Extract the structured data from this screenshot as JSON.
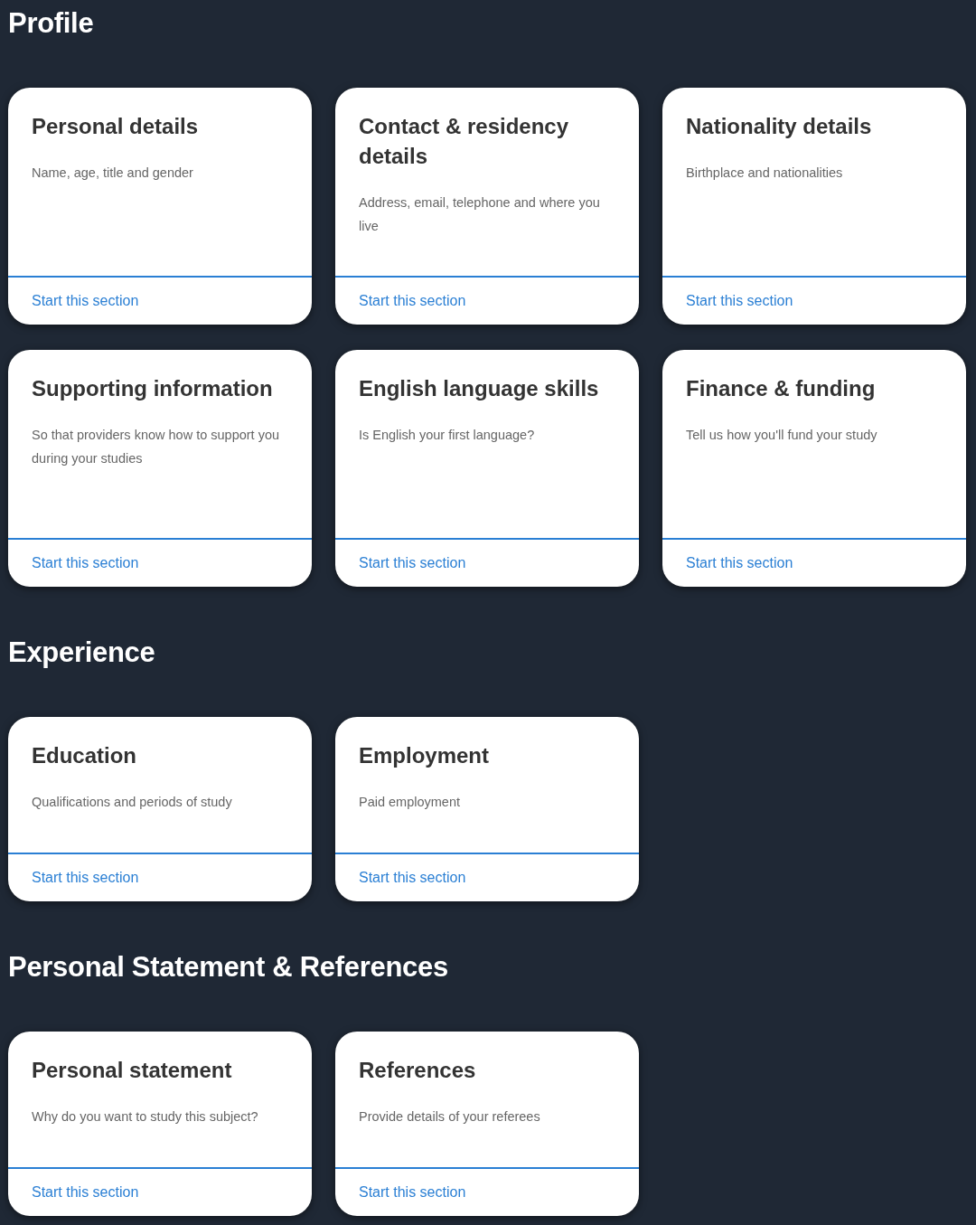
{
  "sections": [
    {
      "title": "Profile",
      "cards": [
        {
          "title": "Personal details",
          "description": "Name, age, title and gender",
          "link": "Start this section"
        },
        {
          "title": "Contact & residency details",
          "description": "Address, email, telephone and where you live",
          "link": "Start this section"
        },
        {
          "title": "Nationality details",
          "description": "Birthplace and nationalities",
          "link": "Start this section"
        },
        {
          "title": "Supporting information",
          "description": "So that providers know how to support you during your studies",
          "link": "Start this section"
        },
        {
          "title": "English language skills",
          "description": "Is English your first language?",
          "link": "Start this section"
        },
        {
          "title": "Finance & funding",
          "description": "Tell us how you'll fund your study",
          "link": "Start this section"
        }
      ]
    },
    {
      "title": "Experience",
      "cards": [
        {
          "title": "Education",
          "description": "Qualifications and periods of study",
          "link": "Start this section"
        },
        {
          "title": "Employment",
          "description": "Paid employment",
          "link": "Start this section"
        }
      ]
    },
    {
      "title": "Personal Statement & References",
      "cards": [
        {
          "title": "Personal statement",
          "description": "Why do you want to study this subject?",
          "link": "Start this section"
        },
        {
          "title": "References",
          "description": "Provide details of your referees",
          "link": "Start this section"
        }
      ]
    }
  ]
}
